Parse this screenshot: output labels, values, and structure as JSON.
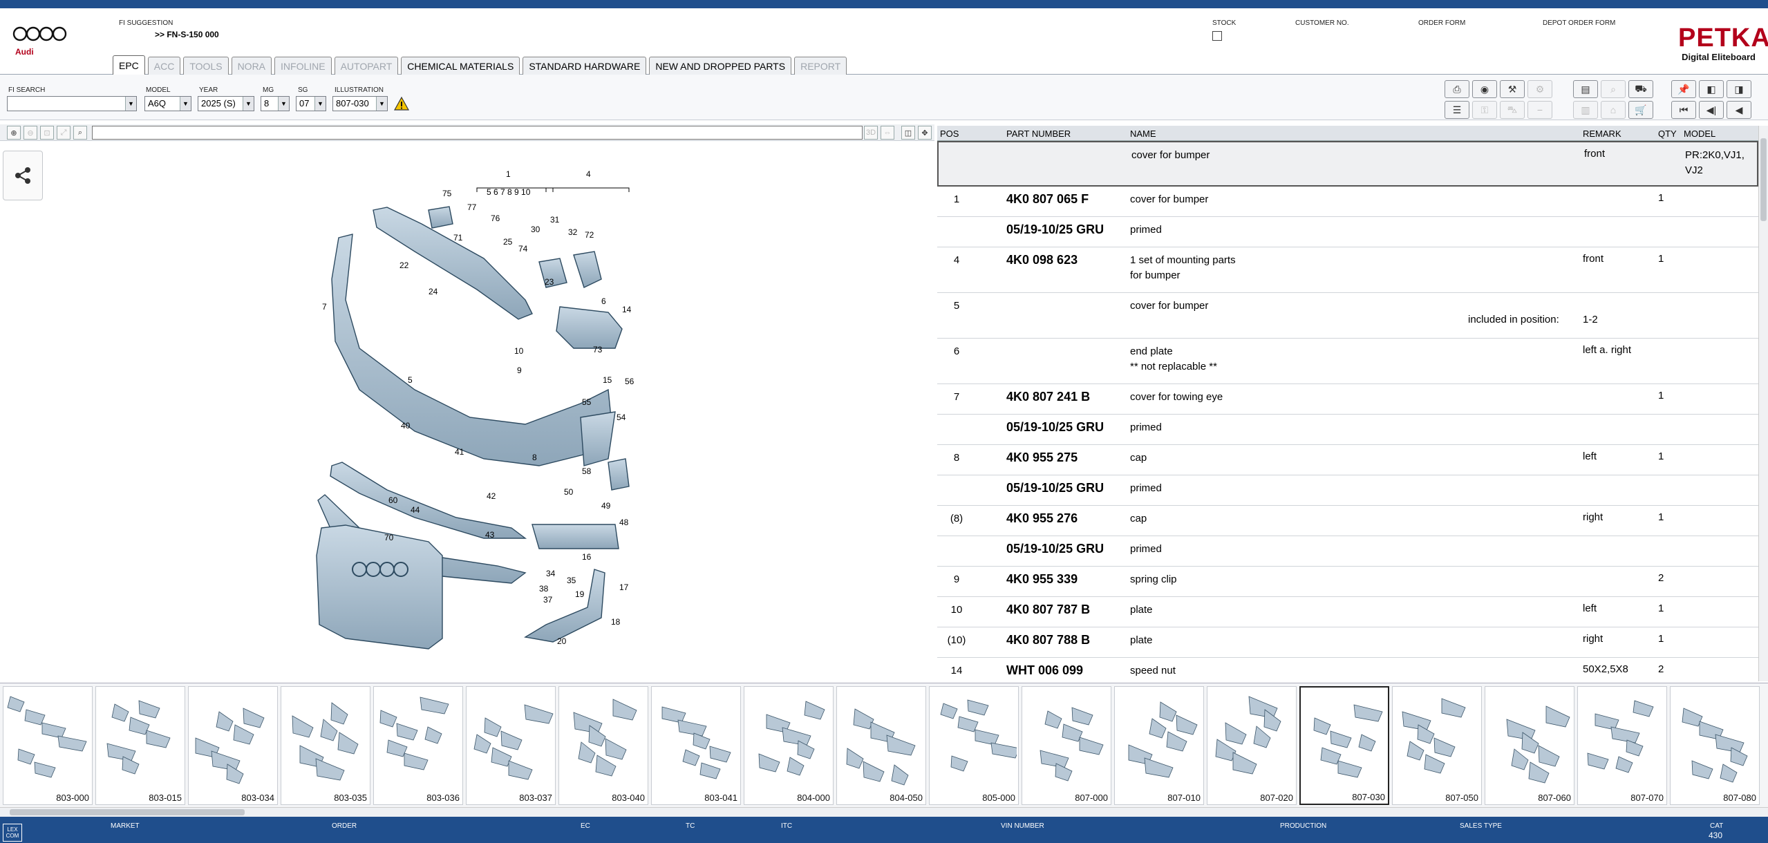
{
  "brand": {
    "logo_text": "Audi",
    "petka_title": "PETKA",
    "petka_sub": "Digital Eliteboard"
  },
  "header": {
    "fi_suggestion_label": "FI SUGGESTION",
    "fi_suggestion_value": ">> FN-S-150 000",
    "stock_label": "STOCK",
    "customer_label": "CUSTOMER NO.",
    "order_form_label": "ORDER FORM",
    "depot_order_label": "DEPOT ORDER FORM"
  },
  "tabs": [
    {
      "label": "EPC",
      "state": "active"
    },
    {
      "label": "ACC",
      "state": "disabled"
    },
    {
      "label": "TOOLS",
      "state": "disabled"
    },
    {
      "label": "NORA",
      "state": "disabled"
    },
    {
      "label": "INFOLINE",
      "state": "disabled"
    },
    {
      "label": "AUTOPART",
      "state": "disabled"
    },
    {
      "label": "CHEMICAL MATERIALS",
      "state": "normal"
    },
    {
      "label": "STANDARD HARDWARE",
      "state": "normal"
    },
    {
      "label": "NEW AND DROPPED PARTS",
      "state": "normal"
    },
    {
      "label": "REPORT",
      "state": "disabled"
    }
  ],
  "filters": {
    "fi_search_label": "FI SEARCH",
    "fi_search_value": "",
    "model_label": "MODEL",
    "model_value": "A6Q",
    "year_label": "YEAR",
    "year_value": "2025 (S)",
    "mg_label": "MG",
    "mg_value": "8",
    "sg_label": "SG",
    "sg_value": "07",
    "illustration_label": "ILLUSTRATION",
    "illustration_value": "807-030"
  },
  "parts_table": {
    "headers": {
      "pos": "POS",
      "part_number": "PART NUMBER",
      "name": "NAME",
      "remark": "REMARK",
      "qty": "QTY",
      "model": "MODEL"
    },
    "rows": [
      {
        "pos": "",
        "part_number": "",
        "name": "cover for bumper",
        "remark": "front",
        "qty": "",
        "model": "PR:2K0,VJ1,\nVJ2"
      },
      {
        "pos": "1",
        "part_number": "4K0 807 065 F",
        "name": "cover for bumper",
        "remark": "",
        "qty": "1",
        "model": ""
      },
      {
        "pos": "",
        "part_number": "05/19-10/25 GRU",
        "name": "primed",
        "remark": "",
        "qty": "",
        "model": ""
      },
      {
        "pos": "4",
        "part_number": "4K0 098 623",
        "name": "1 set of mounting parts\nfor bumper",
        "remark": "front",
        "qty": "1",
        "model": ""
      },
      {
        "pos": "5",
        "part_number": "",
        "name": "cover for bumper",
        "remark": "",
        "qty": "",
        "model": "",
        "included_label": "included in position:",
        "included_value": "1-2"
      },
      {
        "pos": "6",
        "part_number": "",
        "name": "end plate\n** not replacable **",
        "remark": "left a. right",
        "qty": "",
        "model": ""
      },
      {
        "pos": "7",
        "part_number": "4K0 807 241 B",
        "name": "cover for towing eye",
        "remark": "",
        "qty": "1",
        "model": ""
      },
      {
        "pos": "",
        "part_number": "05/19-10/25 GRU",
        "name": "primed",
        "remark": "",
        "qty": "",
        "model": ""
      },
      {
        "pos": "8",
        "part_number": "4K0 955 275",
        "name": "cap",
        "remark": "left",
        "qty": "1",
        "model": ""
      },
      {
        "pos": "",
        "part_number": "05/19-10/25 GRU",
        "name": "primed",
        "remark": "",
        "qty": "",
        "model": ""
      },
      {
        "pos": "(8)",
        "part_number": "4K0 955 276",
        "name": "cap",
        "remark": "right",
        "qty": "1",
        "model": ""
      },
      {
        "pos": "",
        "part_number": "05/19-10/25 GRU",
        "name": "primed",
        "remark": "",
        "qty": "",
        "model": ""
      },
      {
        "pos": "9",
        "part_number": "4K0 955 339",
        "name": "spring clip",
        "remark": "",
        "qty": "2",
        "model": ""
      },
      {
        "pos": "10",
        "part_number": "4K0 807 787 B",
        "name": "plate",
        "remark": "left",
        "qty": "1",
        "model": ""
      },
      {
        "pos": "(10)",
        "part_number": "4K0 807 788 B",
        "name": "plate",
        "remark": "right",
        "qty": "1",
        "model": ""
      },
      {
        "pos": "14",
        "part_number": "WHT 006 099",
        "name": "speed nut",
        "remark": "50X2,5X8",
        "qty": "2",
        "model": ""
      }
    ]
  },
  "diagram_labels": [
    "1",
    "4",
    "5",
    "6",
    "7",
    "8",
    "9",
    "10",
    "14",
    "15",
    "16",
    "17",
    "18",
    "19",
    "20",
    "22",
    "23",
    "24",
    "25",
    "30",
    "31",
    "32",
    "34",
    "35",
    "37",
    "38",
    "40",
    "41",
    "42",
    "43",
    "44",
    "48",
    "49",
    "50",
    "54",
    "55",
    "56",
    "58",
    "60",
    "70",
    "71",
    "72",
    "73",
    "74",
    "75",
    "76",
    "77"
  ],
  "diagram_sublabels": "5 6 7 8 9 10",
  "thumbnails": [
    "803-000",
    "803-015",
    "803-034",
    "803-035",
    "803-036",
    "803-037",
    "803-040",
    "803-041",
    "804-000",
    "804-050",
    "805-000",
    "807-000",
    "807-010",
    "807-020",
    "807-030",
    "807-050",
    "807-060",
    "807-070",
    "807-080"
  ],
  "active_thumbnail": "807-030",
  "status_bar": {
    "lexcom": "LEX\nCOM",
    "market": "MARKET",
    "order": "ORDER",
    "ec": "EC",
    "tc": "TC",
    "itc": "ITC",
    "vin": "VIN NUMBER",
    "production": "PRODUCTION",
    "sales_type": "SALES TYPE",
    "cat_label": "CAT",
    "cat_value": "430"
  },
  "colors": {
    "brand_blue": "#1f4e8c",
    "petka_red": "#b3001b"
  }
}
